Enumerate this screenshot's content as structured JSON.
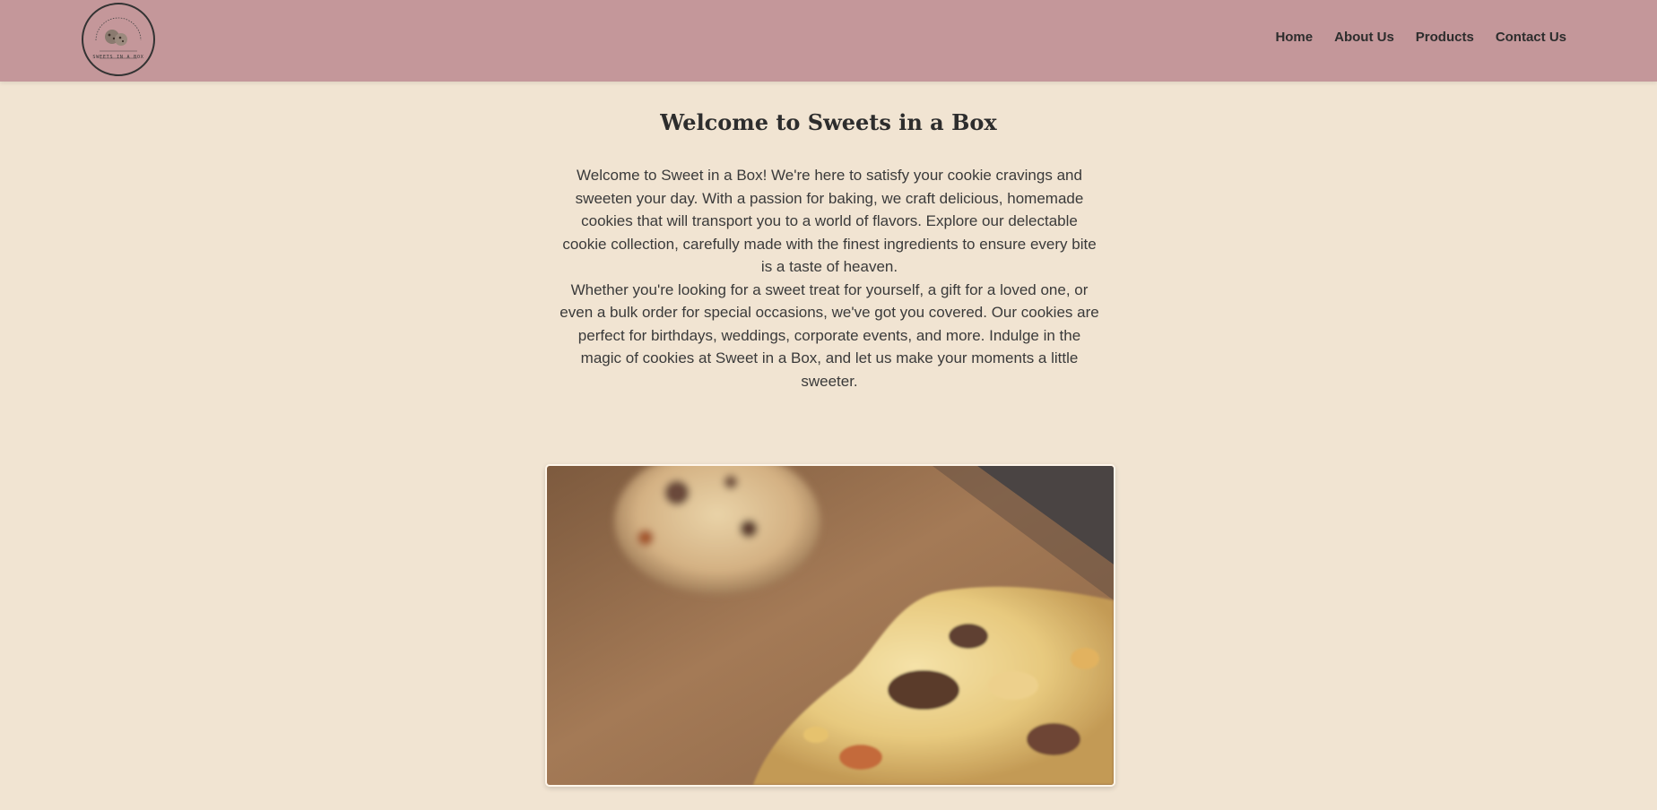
{
  "header": {
    "logo": {
      "text": "SWEETS IN A BOX",
      "icon": "cookie-icon"
    },
    "nav": [
      {
        "label": "Home"
      },
      {
        "label": "About Us"
      },
      {
        "label": "Products"
      },
      {
        "label": "Contact Us"
      }
    ]
  },
  "main": {
    "title": "Welcome to Sweets in a Box",
    "paragraphs": [
      "Welcome to Sweet in a Box! We're here to satisfy your cookie cravings and sweeten your day. With a passion for baking, we craft delicious, homemade cookies that will transport you to a world of flavors. Explore our delectable cookie collection, carefully made with the finest ingredients to ensure every bite is a taste of heaven.",
      "Whether you're looking for a sweet treat for yourself, a gift for a loved one, or even a bulk order for special occasions, we've got you covered. Our cookies are perfect for birthdays, weddings, corporate events, and more. Indulge in the magic of cookies at Sweet in a Box, and let us make your moments a little sweeter."
    ],
    "image": {
      "subject": "chocolate-chip-cookies-photo"
    }
  },
  "colors": {
    "header_bg": "#c4979a",
    "page_bg": "#f1e4d2",
    "text": "#333333"
  }
}
